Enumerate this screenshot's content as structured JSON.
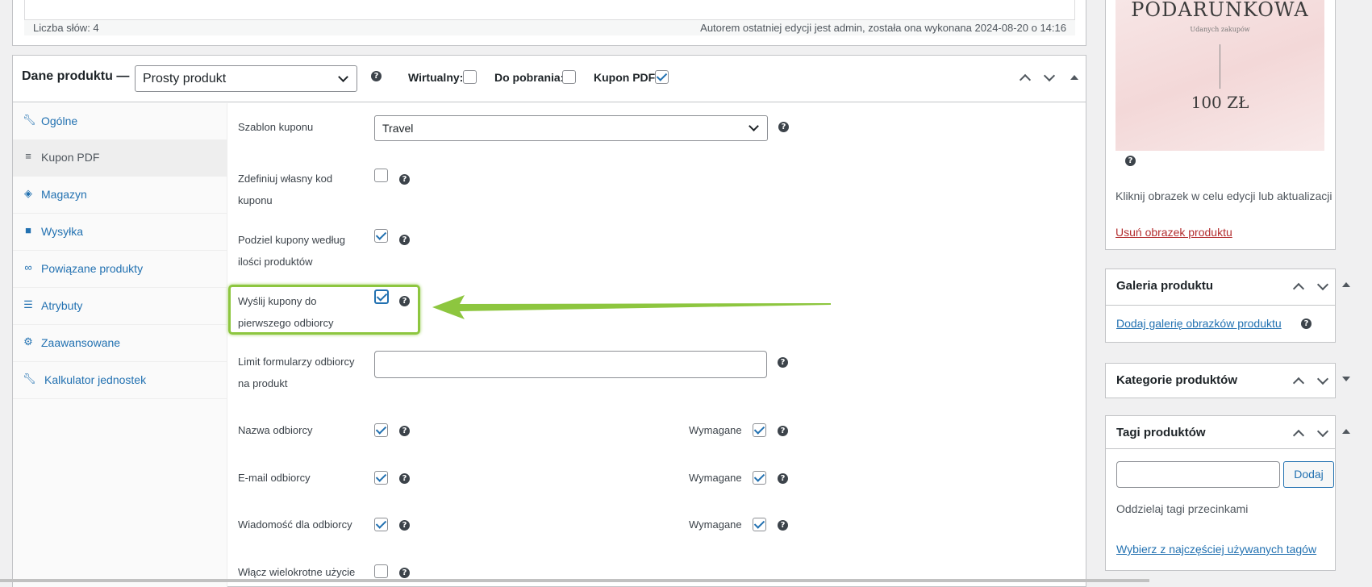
{
  "editor": {
    "word_count": "Liczba słów: 4",
    "last_edit": "Autorem ostatniej edycji jest admin, została ona wykonana 2024-08-20 o 14:16"
  },
  "product_data": {
    "title": "Dane produktu —",
    "type_selected": "Prosty produkt",
    "virtual_label": "Wirtualny:",
    "virtual_checked": false,
    "downloadable_label": "Do pobrania:",
    "downloadable_checked": false,
    "pdf_coupon_label": "Kupon PDF:",
    "pdf_coupon_checked": true
  },
  "tabs": [
    {
      "label": "Ogólne",
      "icon": "wrench-icon"
    },
    {
      "label": "Kupon PDF",
      "icon": "ticket-icon"
    },
    {
      "label": "Magazyn",
      "icon": "tag-icon"
    },
    {
      "label": "Wysyłka",
      "icon": "truck-icon"
    },
    {
      "label": "Powiązane produkty",
      "icon": "link-icon"
    },
    {
      "label": "Atrybuty",
      "icon": "list-icon"
    },
    {
      "label": "Zaawansowane",
      "icon": "gear-icon"
    },
    {
      "label": "Kalkulator jednostek",
      "icon": "wrench-icon"
    }
  ],
  "fields": {
    "template_label": "Szablon kuponu",
    "template_value": "Travel",
    "custom_code_label": "Zdefiniuj własny kod kuponu",
    "custom_code_checked": false,
    "split_label": "Podziel kupony według ilości produktów",
    "split_checked": true,
    "send_first_label": "Wyślij kupony do pierwszego odbiorcy",
    "send_first_checked": true,
    "limit_label": "Limit formularzy odbiorcy na produkt",
    "limit_value": "",
    "recipient_name_label": "Nazwa odbiorcy",
    "recipient_email_label": "E-mail odbiorcy",
    "recipient_message_label": "Wiadomość dla odbiorcy",
    "required_label": "Wymagane",
    "multi_use_label": "Włącz wielokrotne użycie"
  },
  "sidebar": {
    "image_text_line1": "PODARUNKOWA",
    "image_text_line2": "Udanych zakupów",
    "image_text_price": "100 ZŁ",
    "image_hint": "Kliknij obrazek w celu edycji lub aktualizacji",
    "remove_image": "Usuń obrazek produktu",
    "gallery_title": "Galeria produktu",
    "gallery_link": "Dodaj galerię obrazków produktu",
    "categories_title": "Kategorie produktów",
    "tags_title": "Tagi produktów",
    "tags_input_value": "",
    "tags_add_button": "Dodaj",
    "tags_hint": "Oddzielaj tagi przecinkami",
    "tags_most_used": "Wybierz z najczęściej używanych tagów"
  },
  "colors": {
    "accent": "#2271b1",
    "highlight": "#8dc63f"
  }
}
